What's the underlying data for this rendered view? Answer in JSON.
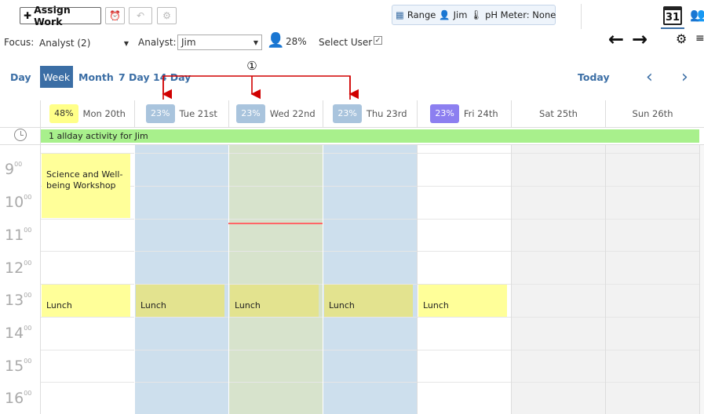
{
  "toolbar": {
    "assign_work_label": "Assign Work",
    "range_label": "Range",
    "user_label": "Jim",
    "meter_label": "pH Meter: None"
  },
  "filters": {
    "focus_label": "Focus:",
    "focus_value": "Analyst (2)",
    "analyst_label": "Analyst:",
    "analyst_value": "Jim",
    "workload": "28%",
    "select_user_label": "Select User"
  },
  "nav": {
    "views": [
      "Day",
      "Week",
      "Month",
      "7 Day",
      "14 Day"
    ],
    "active_view": "Week",
    "today_label": "Today",
    "prev": "‹",
    "next": "›"
  },
  "callout": "①",
  "calendar_icon_label": "31",
  "days": [
    {
      "label": "Mon 20th",
      "pct": "48%",
      "pct_color": "#ffff88",
      "pct_text": "#333"
    },
    {
      "label": "Tue 21st",
      "pct": "23%",
      "pct_color": "#a9c4dd",
      "pct_text": "#fff"
    },
    {
      "label": "Wed 22nd",
      "pct": "23%",
      "pct_color": "#a9c4dd",
      "pct_text": "#fff"
    },
    {
      "label": "Thu 23rd",
      "pct": "23%",
      "pct_color": "#a9c4dd",
      "pct_text": "#fff"
    },
    {
      "label": "Fri 24th",
      "pct": "23%",
      "pct_color": "#8c7ff0",
      "pct_text": "#fff"
    },
    {
      "label": "Sat 25th",
      "pct": "",
      "pct_color": "",
      "pct_text": ""
    },
    {
      "label": "Sun 26th",
      "pct": "",
      "pct_color": "",
      "pct_text": ""
    }
  ],
  "allday": {
    "text": "1 allday activity for Jim"
  },
  "hours": [
    "9",
    "10",
    "11",
    "12",
    "13",
    "14",
    "15",
    "16"
  ],
  "minutes_sup": "00",
  "events": {
    "workshop": "Science and Well-being Workshop",
    "lunch": "Lunch"
  },
  "colors": {
    "accent": "#3b6ea5",
    "allday": "#a8f08c",
    "highlight_blue": "#cddfed",
    "highlight_green": "#d7e3cc",
    "weekend": "#f2f2f2",
    "event_yellow": "#ffff99",
    "lunch_dim": "#e3e38f",
    "arrow_red": "#d00000",
    "now_line": "#ff6666"
  }
}
